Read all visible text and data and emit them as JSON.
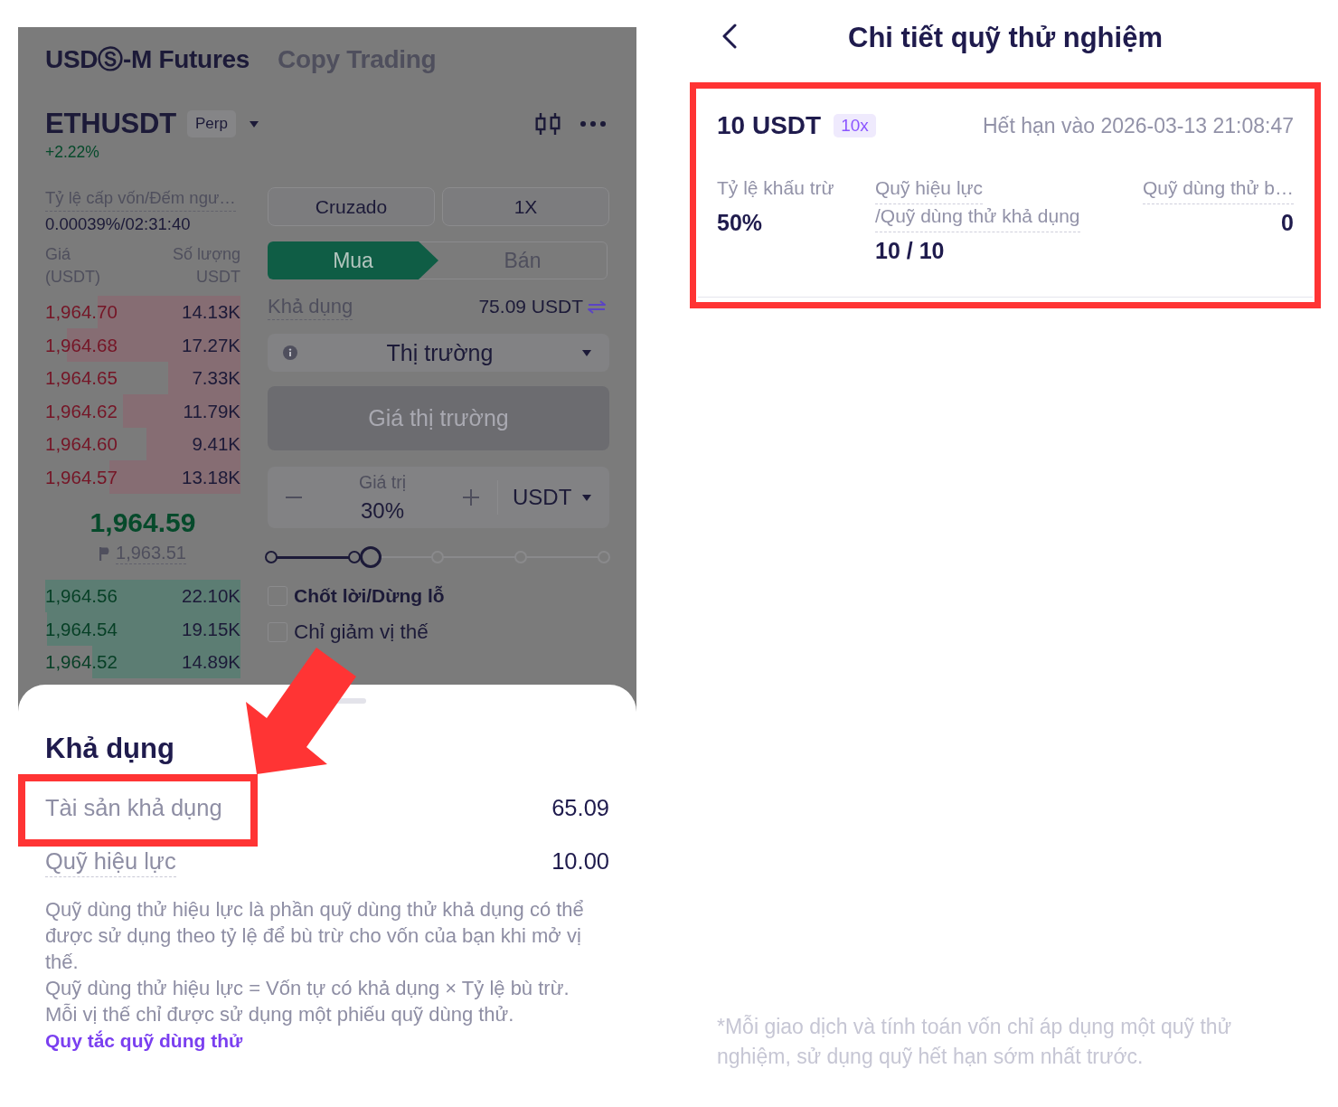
{
  "trading_screen": {
    "dimmed": true,
    "header_tabs": [
      {
        "label": "USDⓈ-M Futures",
        "selected": true
      },
      {
        "label": "Copy Trading",
        "selected": false
      }
    ],
    "symbol": {
      "name": "ETHUSDT",
      "tag": "Perp",
      "change": "+2.22%"
    },
    "order_book": {
      "funding_label": "Tỷ lệ cấp vốn/Đếm ngư…",
      "funding_value": "0.00039%/02:31:40",
      "columns": [
        {
          "title": "Giá",
          "unit": "(USDT)"
        },
        {
          "title": "Số lượng",
          "unit": "USDT"
        }
      ],
      "asks": [
        {
          "price": "1,964.70",
          "amount": "14.13K"
        },
        {
          "price": "1,964.68",
          "amount": "17.27K"
        },
        {
          "price": "1,964.65",
          "amount": "7.33K"
        },
        {
          "price": "1,964.62",
          "amount": "11.79K"
        },
        {
          "price": "1,964.60",
          "amount": "9.41K"
        },
        {
          "price": "1,964.57",
          "amount": "13.18K"
        }
      ],
      "last_price": "1,964.59",
      "mark_price": "1,963.51",
      "bids": [
        {
          "price": "1,964.56",
          "amount": "22.10K"
        },
        {
          "price": "1,964.54",
          "amount": "19.15K"
        },
        {
          "price": "1,964.52",
          "amount": "14.89K"
        }
      ]
    },
    "order_form": {
      "margin_mode": "Cruzado",
      "leverage": "1X",
      "sides": [
        {
          "label": "Mua",
          "selected": true
        },
        {
          "label": "Bán",
          "selected": false
        }
      ],
      "available": {
        "label": "Khả dụng",
        "value": "75.09 USDT"
      },
      "order_type": "Thị trường",
      "price_field": {
        "placeholder": "Giá thị trường",
        "disabled": true
      },
      "amount": {
        "label": "Giá trị",
        "value": "30%",
        "unit": "USDT"
      },
      "slider": {
        "level": 0.3
      },
      "options": [
        {
          "label": "Chốt lời/Dừng lỗ",
          "checked": false,
          "kind": "primary"
        },
        {
          "label": "Chỉ giảm vị thế",
          "checked": false,
          "kind": "secondary"
        }
      ]
    }
  },
  "bottom_sheet": {
    "title": "Khả dụng",
    "callout_arrow": true,
    "rows": [
      {
        "label": "Tài sản khả dụng",
        "value": "65.09",
        "tooltip": false,
        "highlighted": true
      },
      {
        "label": "Quỹ hiệu lực",
        "value": "10.00",
        "tooltip": true,
        "highlighted": false
      }
    ],
    "description": [
      "Quỹ dùng thử hiệu lực là phần quỹ dùng thử khả dụng có thể được sử dụng theo tỷ lệ để bù trừ cho vốn của bạn khi mở vị thế.",
      "Quỹ dùng thử hiệu lực = Vốn tự có khả dụng × Tỷ lệ bù trừ.",
      "Mỗi vị thế chỉ được sử dụng một phiếu quỹ dùng thử."
    ],
    "link": "Quy tắc quỹ dùng thử"
  },
  "fund_detail": {
    "title": "Chi tiết quỹ thử nghiệm",
    "card": {
      "highlighted": true,
      "amount": "10 USDT",
      "leverage": "10x",
      "expiry": "Hết hạn vào 2026-03-13 21:08:47",
      "stats": [
        {
          "labels": [
            "Tỷ lệ khấu trừ"
          ],
          "value": "50%",
          "tooltip": false
        },
        {
          "labels": [
            "Quỹ hiệu lực",
            "/Quỹ dùng thử khả dụng"
          ],
          "value": "10 / 10",
          "tooltip": true
        },
        {
          "labels": [
            "Quỹ dùng thử b…"
          ],
          "value": "0",
          "tooltip": true
        }
      ]
    },
    "footnote": "*Mỗi giao dịch và tính toán vốn chỉ áp dụng một quỹ thử nghiệm, sử dụng quỹ hết hạn sớm nhất trước."
  }
}
